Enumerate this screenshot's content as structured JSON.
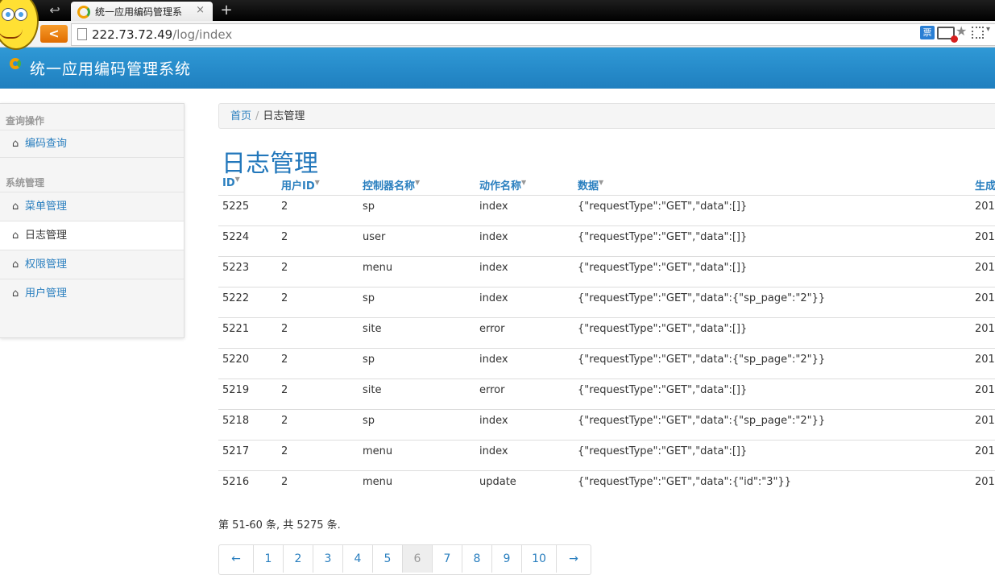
{
  "browser": {
    "tab_title": "统一应用编码管理系",
    "tab_close": "×",
    "new_tab": "+",
    "url_host": "222.73.72.49",
    "url_path": "/log/index",
    "ticket_icon_label": "票"
  },
  "app": {
    "title": "统一应用编码管理系统"
  },
  "sidebar": {
    "groups": [
      {
        "header": "查询操作",
        "items": [
          {
            "label": "编码查询"
          }
        ]
      },
      {
        "header": "系统管理",
        "items": [
          {
            "label": "菜单管理"
          },
          {
            "label": "日志管理",
            "active": true
          },
          {
            "label": "权限管理"
          },
          {
            "label": "用户管理"
          }
        ]
      }
    ]
  },
  "breadcrumb": {
    "home": "首页",
    "separator": "/",
    "current": "日志管理"
  },
  "page": {
    "title": "日志管理"
  },
  "table": {
    "columns": [
      "ID",
      "用户ID",
      "控制器名称",
      "动作名称",
      "数据",
      "生成"
    ],
    "rows": [
      [
        "5225",
        "2",
        "sp",
        "index",
        "{\"requestType\":\"GET\",\"data\":[]}",
        "201"
      ],
      [
        "5224",
        "2",
        "user",
        "index",
        "{\"requestType\":\"GET\",\"data\":[]}",
        "201"
      ],
      [
        "5223",
        "2",
        "menu",
        "index",
        "{\"requestType\":\"GET\",\"data\":[]}",
        "201"
      ],
      [
        "5222",
        "2",
        "sp",
        "index",
        "{\"requestType\":\"GET\",\"data\":{\"sp_page\":\"2\"}}",
        "201"
      ],
      [
        "5221",
        "2",
        "site",
        "error",
        "{\"requestType\":\"GET\",\"data\":[]}",
        "201"
      ],
      [
        "5220",
        "2",
        "sp",
        "index",
        "{\"requestType\":\"GET\",\"data\":{\"sp_page\":\"2\"}}",
        "201"
      ],
      [
        "5219",
        "2",
        "site",
        "error",
        "{\"requestType\":\"GET\",\"data\":[]}",
        "201"
      ],
      [
        "5218",
        "2",
        "sp",
        "index",
        "{\"requestType\":\"GET\",\"data\":{\"sp_page\":\"2\"}}",
        "201"
      ],
      [
        "5217",
        "2",
        "menu",
        "index",
        "{\"requestType\":\"GET\",\"data\":[]}",
        "201"
      ],
      [
        "5216",
        "2",
        "menu",
        "update",
        "{\"requestType\":\"GET\",\"data\":{\"id\":\"3\"}}",
        "201"
      ]
    ]
  },
  "summary": "第 51-60 条, 共 5275 条.",
  "pagination": {
    "prev": "←",
    "pages": [
      "1",
      "2",
      "3",
      "4",
      "5",
      "6",
      "7",
      "8",
      "9",
      "10"
    ],
    "active": "6",
    "next": "→"
  }
}
